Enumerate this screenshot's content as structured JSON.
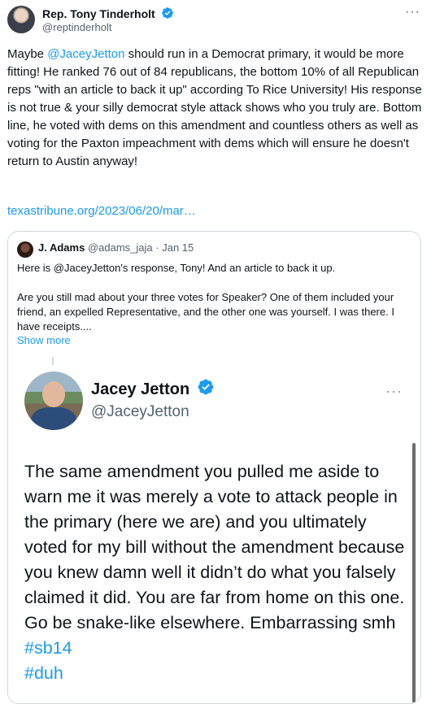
{
  "tweet": {
    "author_name": "Rep. Tony Tinderholt",
    "author_handle": "@reptinderholt",
    "more_label": "···",
    "text_parts": {
      "p1": "Maybe ",
      "mention": "@JaceyJetton",
      "p2": " should run in a Democrat primary, it would be more fitting! He ranked 76 out of 84 republicans, the bottom 10% of all Republican reps \"with an article to back it up\" according To Rice University! His response is not true & your silly democrat style attack shows who you truly are. Bottom line, he voted with dems on this amendment and countless others as well as voting for the Paxton impeachment with dems which will ensure he doesn't return to Austin anyway!"
    },
    "link": "texastribune.org/2023/06/20/mar…"
  },
  "quote": {
    "author_name": "J. Adams",
    "author_handle": "@adams_jaja",
    "separator": "·",
    "date": "Jan 15",
    "line1": "Here is @JaceyJetton's response, Tony! And an article to back it up.",
    "line2": "Are you still mad about your three votes for Speaker? One of them included your friend, an expelled Representative, and the other one was yourself. I was there. I have receipts....",
    "show_more": "Show more"
  },
  "inner": {
    "author_name": "Jacey Jetton",
    "author_handle": "@JaceyJetton",
    "more_label": "···",
    "text": "The same amendment you pulled me aside to warn me it was merely a vote to attack people in the primary (here we are) and you ultimately voted for my bill without the amendment because you knew damn well it didn’t do what you falsely claimed it did. You are far from home on this one. Go be snake-like elsewhere. Embarrassing smh ",
    "hashtag1": "#sb14",
    "hashtag2": "#duh"
  },
  "colors": {
    "link_blue": "#1d9bf0",
    "text_primary": "#0f1419",
    "text_secondary": "#536471",
    "border": "#cfd9de"
  },
  "icons": [
    "verified-badge-icon",
    "more-options-icon"
  ]
}
